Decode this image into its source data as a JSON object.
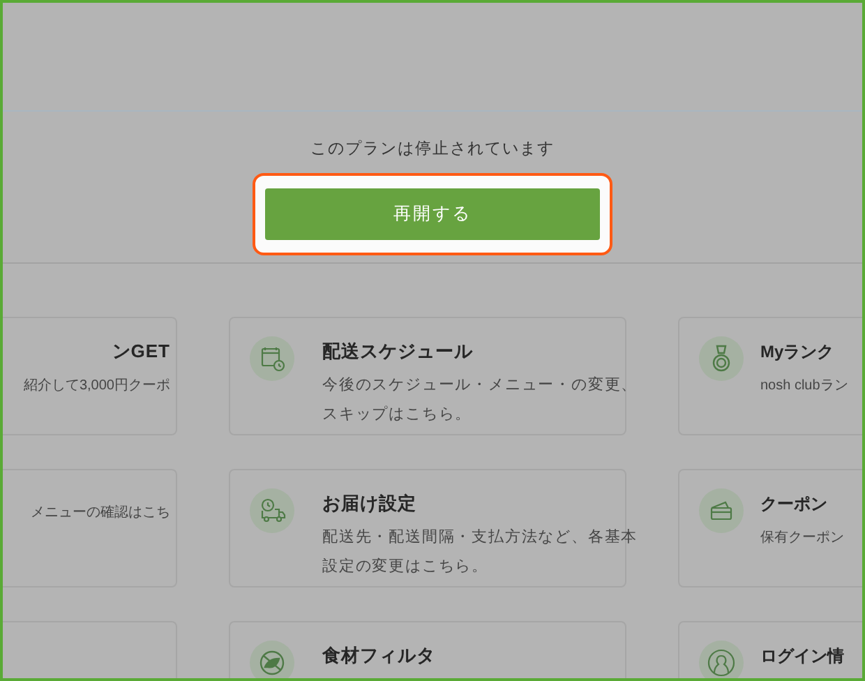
{
  "notice": {
    "message": "このプランは停止されています",
    "button": "再開する"
  },
  "rows": [
    [
      {
        "title": "ンGET",
        "description": "紹介して3,000円クーポ"
      },
      {
        "title": "配送スケジュール",
        "description": "今後のスケジュール・メニュー・の変更、スキップはこちら。"
      },
      {
        "title": "Myランク",
        "description": "nosh clubラン"
      }
    ],
    [
      {
        "description": "メニューの確認はこち"
      },
      {
        "title": "お届け設定",
        "description": "配送先・配送間隔・支払方法など、各基本設定の変更はこちら。"
      },
      {
        "title": "クーポン",
        "description": "保有クーポン"
      }
    ],
    [
      {},
      {
        "title": "食材フィルタ"
      },
      {
        "title": "ログイン情"
      }
    ]
  ]
}
